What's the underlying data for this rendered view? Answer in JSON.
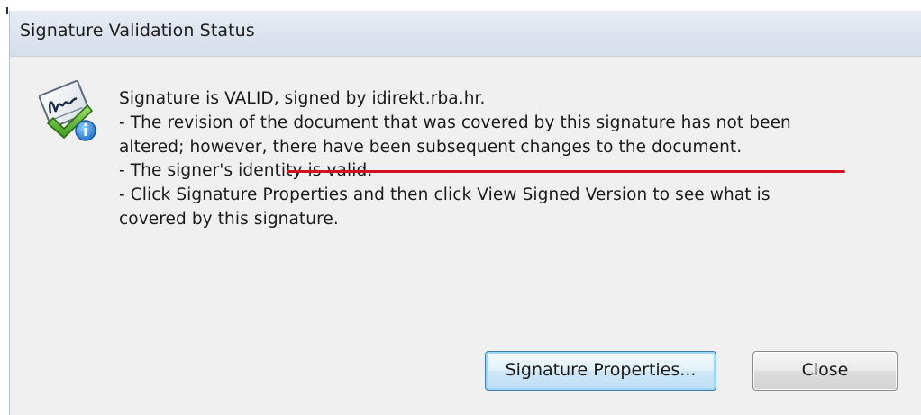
{
  "dialog": {
    "title": "Signature Validation Status",
    "icon": "signature-valid-icon",
    "message_lines": [
      "Signature is VALID, signed by idirekt.rba.hr.",
      "- The revision of the document that was covered by this signature has not been",
      "altered; however, ",
      "there have been subsequent changes to the document.",
      "- The signer's identity is valid.",
      "- Click Signature Properties and then click View Signed Version to see what is",
      "covered by this signature."
    ],
    "highlight_color": "#d21020"
  },
  "buttons": {
    "signature_properties": "Signature Properties...",
    "close": "Close"
  }
}
